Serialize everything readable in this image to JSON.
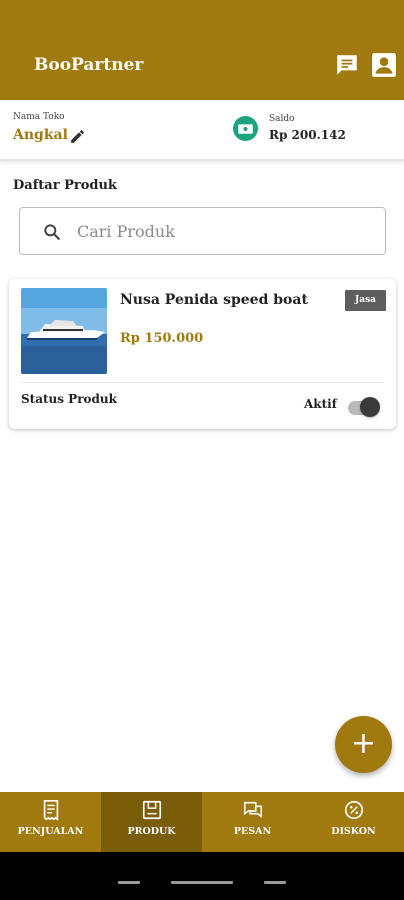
{
  "app": {
    "title": "BooPartner"
  },
  "store": {
    "name_label": "Nama Toko",
    "name": "Angkal",
    "balance_label": "Saldo",
    "balance": "Rp 200.142"
  },
  "products_section": {
    "title": "Daftar Produk"
  },
  "search": {
    "placeholder": "Cari Produk"
  },
  "products": [
    {
      "name": "Nusa Penida speed boat",
      "type_badge": "Jasa",
      "price": "Rp 150.000",
      "status_label": "Status Produk",
      "status_value": "Aktif"
    }
  ],
  "bottom_nav": {
    "items": [
      {
        "label": "PENJUALAN",
        "icon": "receipt-icon"
      },
      {
        "label": "PRODUK",
        "icon": "box-icon"
      },
      {
        "label": "PESAN",
        "icon": "chat-bubbles-icon"
      },
      {
        "label": "DISKON",
        "icon": "discount-icon"
      }
    ]
  },
  "colors": {
    "primary": "#a07a0e",
    "primary_dark": "#7a5d08",
    "wallet": "#1aa57c"
  }
}
